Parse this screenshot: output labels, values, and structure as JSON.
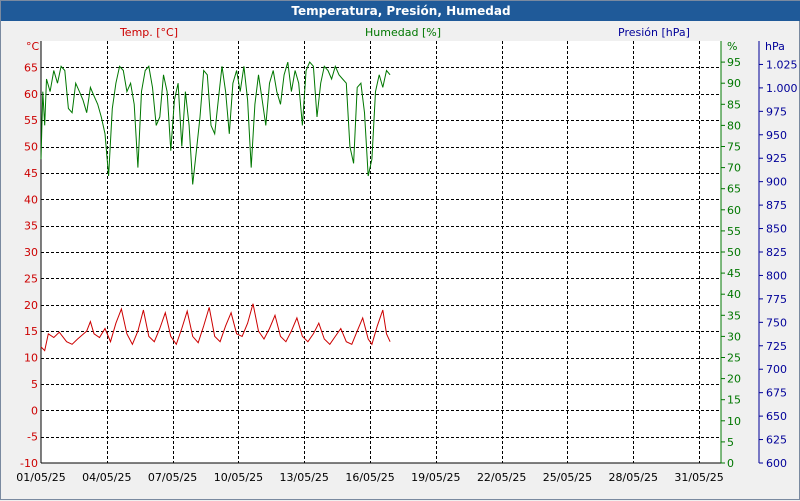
{
  "window": {
    "title": "Temperatura, Presión, Humedad"
  },
  "colors": {
    "temp": "#cc0000",
    "hum": "#007700",
    "pres": "#000099",
    "grid": "#000000",
    "background": "#ffffff",
    "titlebar": "#1f5a99"
  },
  "chart_data": {
    "type": "line",
    "title": "Temperatura, Presión, Humedad",
    "grid": true,
    "x": {
      "type": "date",
      "range": [
        "2025-05-01",
        "2025-06-01"
      ],
      "tick_labels": [
        "01/05/25",
        "04/05/25",
        "07/05/25",
        "10/05/25",
        "13/05/25",
        "16/05/25",
        "19/05/25",
        "22/05/25",
        "25/05/25",
        "28/05/25",
        "31/05/25"
      ]
    },
    "axes": {
      "temp": {
        "label": "Temp. [°C]",
        "unit": "°C",
        "min": -10,
        "max": 70,
        "ticks": [
          "65",
          "60",
          "55",
          "50",
          "45",
          "40",
          "35",
          "30",
          "25",
          "20",
          "15",
          "10",
          "5",
          "0",
          "-5",
          "-10"
        ]
      },
      "hum": {
        "label": "Humedad [%]",
        "unit": "%",
        "min": 0,
        "max": 100,
        "ticks": [
          "95",
          "90",
          "85",
          "80",
          "75",
          "70",
          "65",
          "60",
          "55",
          "50",
          "45",
          "40",
          "35",
          "30",
          "25",
          "20",
          "15",
          "10",
          "5",
          "0"
        ]
      },
      "pres": {
        "label": "Presión [hPa]",
        "unit": "hPa",
        "min": 600,
        "max": 1050,
        "ticks": [
          "1.025",
          "1.000",
          "975",
          "950",
          "925",
          "900",
          "875",
          "850",
          "825",
          "800",
          "775",
          "750",
          "725",
          "700",
          "675",
          "650",
          "625",
          "600"
        ]
      }
    },
    "series": [
      {
        "name": "Temp. [°C]",
        "axis": "temp",
        "points": [
          [
            "2025-05-01 00:00",
            12.0
          ],
          [
            "2025-05-01 04:00",
            11.3
          ],
          [
            "2025-05-01 08:00",
            14.5
          ],
          [
            "2025-05-01 14:00",
            13.8
          ],
          [
            "2025-05-01 20:00",
            14.8
          ],
          [
            "2025-05-02 04:00",
            13.0
          ],
          [
            "2025-05-02 10:00",
            12.5
          ],
          [
            "2025-05-02 16:00",
            13.5
          ],
          [
            "2025-05-03 02:00",
            15.0
          ],
          [
            "2025-05-03 06:00",
            16.8
          ],
          [
            "2025-05-03 10:00",
            14.5
          ],
          [
            "2025-05-03 16:00",
            13.8
          ],
          [
            "2025-05-03 22:00",
            15.5
          ],
          [
            "2025-05-04 04:00",
            13.0
          ],
          [
            "2025-05-04 10:00",
            16.5
          ],
          [
            "2025-05-04 16:00",
            19.2
          ],
          [
            "2025-05-04 22:00",
            14.5
          ],
          [
            "2025-05-05 04:00",
            12.5
          ],
          [
            "2025-05-05 10:00",
            15.0
          ],
          [
            "2025-05-05 16:00",
            19.0
          ],
          [
            "2025-05-05 22:00",
            14.0
          ],
          [
            "2025-05-06 04:00",
            13.0
          ],
          [
            "2025-05-06 10:00",
            15.5
          ],
          [
            "2025-05-06 16:00",
            18.5
          ],
          [
            "2025-05-06 22:00",
            14.0
          ],
          [
            "2025-05-07 04:00",
            12.5
          ],
          [
            "2025-05-07 10:00",
            15.5
          ],
          [
            "2025-05-07 16:00",
            18.8
          ],
          [
            "2025-05-07 22:00",
            14.0
          ],
          [
            "2025-05-08 04:00",
            12.8
          ],
          [
            "2025-05-08 10:00",
            16.0
          ],
          [
            "2025-05-08 16:00",
            19.5
          ],
          [
            "2025-05-08 22:00",
            14.0
          ],
          [
            "2025-05-09 04:00",
            13.0
          ],
          [
            "2025-05-09 10:00",
            16.0
          ],
          [
            "2025-05-09 16:00",
            18.5
          ],
          [
            "2025-05-09 22:00",
            14.5
          ],
          [
            "2025-05-10 04:00",
            14.0
          ],
          [
            "2025-05-10 10:00",
            16.5
          ],
          [
            "2025-05-10 16:00",
            20.2
          ],
          [
            "2025-05-10 22:00",
            15.0
          ],
          [
            "2025-05-11 04:00",
            13.5
          ],
          [
            "2025-05-11 10:00",
            15.5
          ],
          [
            "2025-05-11 16:00",
            18.0
          ],
          [
            "2025-05-11 22:00",
            14.0
          ],
          [
            "2025-05-12 04:00",
            13.0
          ],
          [
            "2025-05-12 10:00",
            15.0
          ],
          [
            "2025-05-12 16:00",
            17.5
          ],
          [
            "2025-05-12 22:00",
            14.0
          ],
          [
            "2025-05-13 04:00",
            13.0
          ],
          [
            "2025-05-13 10:00",
            14.5
          ],
          [
            "2025-05-13 16:00",
            16.5
          ],
          [
            "2025-05-13 22:00",
            13.5
          ],
          [
            "2025-05-14 04:00",
            12.5
          ],
          [
            "2025-05-14 10:00",
            14.0
          ],
          [
            "2025-05-14 16:00",
            15.5
          ],
          [
            "2025-05-14 22:00",
            13.0
          ],
          [
            "2025-05-15 04:00",
            12.5
          ],
          [
            "2025-05-15 10:00",
            15.0
          ],
          [
            "2025-05-15 16:00",
            17.5
          ],
          [
            "2025-05-15 22:00",
            13.5
          ],
          [
            "2025-05-16 02:00",
            12.5
          ],
          [
            "2025-05-16 08:00",
            16.0
          ],
          [
            "2025-05-16 14:00",
            19.0
          ],
          [
            "2025-05-16 18:00",
            14.5
          ],
          [
            "2025-05-16 22:00",
            13.0
          ]
        ]
      },
      {
        "name": "Humedad [%]",
        "axis": "hum",
        "points": [
          [
            "2025-05-01 00:00",
            72
          ],
          [
            "2025-05-01 02:00",
            88
          ],
          [
            "2025-05-01 04:00",
            80
          ],
          [
            "2025-05-01 06:00",
            91
          ],
          [
            "2025-05-01 10:00",
            88
          ],
          [
            "2025-05-01 14:00",
            93
          ],
          [
            "2025-05-01 18:00",
            90
          ],
          [
            "2025-05-01 22:00",
            94
          ],
          [
            "2025-05-02 02:00",
            93
          ],
          [
            "2025-05-02 06:00",
            84
          ],
          [
            "2025-05-02 10:00",
            83
          ],
          [
            "2025-05-02 14:00",
            90
          ],
          [
            "2025-05-02 18:00",
            88
          ],
          [
            "2025-05-02 22:00",
            86
          ],
          [
            "2025-05-03 02:00",
            83
          ],
          [
            "2025-05-03 06:00",
            89
          ],
          [
            "2025-05-03 10:00",
            87
          ],
          [
            "2025-05-03 14:00",
            85
          ],
          [
            "2025-05-03 18:00",
            82
          ],
          [
            "2025-05-03 22:00",
            78
          ],
          [
            "2025-05-04 02:00",
            68
          ],
          [
            "2025-05-04 06:00",
            84
          ],
          [
            "2025-05-04 10:00",
            90
          ],
          [
            "2025-05-04 14:00",
            94
          ],
          [
            "2025-05-04 18:00",
            93
          ],
          [
            "2025-05-04 22:00",
            88
          ],
          [
            "2025-05-05 02:00",
            90
          ],
          [
            "2025-05-05 06:00",
            85
          ],
          [
            "2025-05-05 10:00",
            70
          ],
          [
            "2025-05-05 14:00",
            88
          ],
          [
            "2025-05-05 18:00",
            93
          ],
          [
            "2025-05-05 22:00",
            94
          ],
          [
            "2025-05-06 02:00",
            89
          ],
          [
            "2025-05-06 06:00",
            80
          ],
          [
            "2025-05-06 10:00",
            82
          ],
          [
            "2025-05-06 14:00",
            92
          ],
          [
            "2025-05-06 18:00",
            88
          ],
          [
            "2025-05-06 22:00",
            74
          ],
          [
            "2025-05-07 02:00",
            86
          ],
          [
            "2025-05-07 06:00",
            90
          ],
          [
            "2025-05-07 10:00",
            75
          ],
          [
            "2025-05-07 14:00",
            88
          ],
          [
            "2025-05-07 18:00",
            80
          ],
          [
            "2025-05-07 22:00",
            66
          ],
          [
            "2025-05-08 02:00",
            74
          ],
          [
            "2025-05-08 06:00",
            82
          ],
          [
            "2025-05-08 10:00",
            93
          ],
          [
            "2025-05-08 14:00",
            92
          ],
          [
            "2025-05-08 18:00",
            80
          ],
          [
            "2025-05-08 22:00",
            78
          ],
          [
            "2025-05-09 02:00",
            86
          ],
          [
            "2025-05-09 06:00",
            94
          ],
          [
            "2025-05-09 10:00",
            88
          ],
          [
            "2025-05-09 14:00",
            78
          ],
          [
            "2025-05-09 18:00",
            90
          ],
          [
            "2025-05-09 22:00",
            93
          ],
          [
            "2025-05-10 02:00",
            88
          ],
          [
            "2025-05-10 06:00",
            94
          ],
          [
            "2025-05-10 10:00",
            86
          ],
          [
            "2025-05-10 14:00",
            70
          ],
          [
            "2025-05-10 18:00",
            85
          ],
          [
            "2025-05-10 22:00",
            92
          ],
          [
            "2025-05-11 02:00",
            86
          ],
          [
            "2025-05-11 06:00",
            80
          ],
          [
            "2025-05-11 10:00",
            90
          ],
          [
            "2025-05-11 14:00",
            93
          ],
          [
            "2025-05-11 18:00",
            88
          ],
          [
            "2025-05-11 22:00",
            85
          ],
          [
            "2025-05-12 02:00",
            92
          ],
          [
            "2025-05-12 06:00",
            95
          ],
          [
            "2025-05-12 10:00",
            88
          ],
          [
            "2025-05-12 14:00",
            93
          ],
          [
            "2025-05-12 18:00",
            90
          ],
          [
            "2025-05-12 22:00",
            80
          ],
          [
            "2025-05-13 02:00",
            93
          ],
          [
            "2025-05-13 06:00",
            95
          ],
          [
            "2025-05-13 10:00",
            94
          ],
          [
            "2025-05-13 14:00",
            82
          ],
          [
            "2025-05-13 18:00",
            90
          ],
          [
            "2025-05-13 22:00",
            94
          ],
          [
            "2025-05-14 02:00",
            93
          ],
          [
            "2025-05-14 06:00",
            91
          ],
          [
            "2025-05-14 10:00",
            94
          ],
          [
            "2025-05-14 14:00",
            92
          ],
          [
            "2025-05-14 18:00",
            91
          ],
          [
            "2025-05-14 22:00",
            90
          ],
          [
            "2025-05-15 02:00",
            75
          ],
          [
            "2025-05-15 06:00",
            71
          ],
          [
            "2025-05-15 10:00",
            89
          ],
          [
            "2025-05-15 14:00",
            90
          ],
          [
            "2025-05-15 18:00",
            83
          ],
          [
            "2025-05-15 22:00",
            68
          ],
          [
            "2025-05-16 02:00",
            72
          ],
          [
            "2025-05-16 06:00",
            88
          ],
          [
            "2025-05-16 10:00",
            92
          ],
          [
            "2025-05-16 14:00",
            89
          ],
          [
            "2025-05-16 18:00",
            93
          ],
          [
            "2025-05-16 22:00",
            92
          ]
        ]
      },
      {
        "name": "Presión [hPa]",
        "axis": "pres",
        "points": []
      }
    ]
  }
}
